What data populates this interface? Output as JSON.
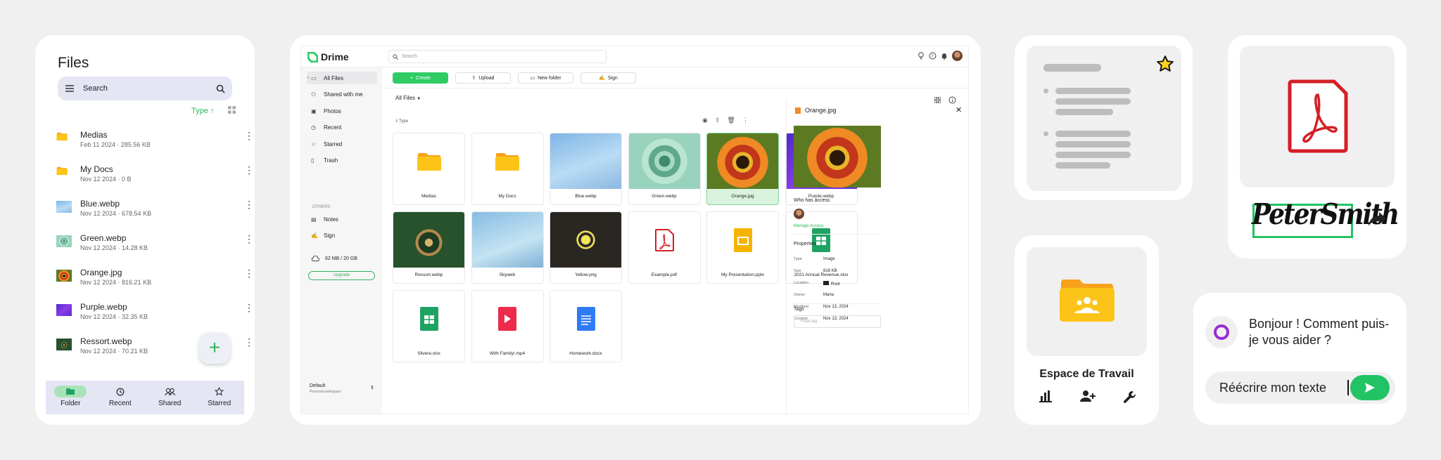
{
  "mobile": {
    "title": "Files",
    "search_placeholder": "Search",
    "sort_label": "Type",
    "files": [
      {
        "name": "Medias",
        "meta": "Feb 11 2024 · 285.56 KB",
        "kind": "folder"
      },
      {
        "name": "My Docs",
        "meta": "Nov 12 2024 · 0 B",
        "kind": "folder"
      },
      {
        "name": "Blue.webp",
        "meta": "Nov 12 2024 · 678.54 KB",
        "kind": "blue"
      },
      {
        "name": "Green.webp",
        "meta": "Nov 12 2024 · 14.28 KB",
        "kind": "green"
      },
      {
        "name": "Orange.jpg",
        "meta": "Nov 12 2024 · 816.21 KB",
        "kind": "orange"
      },
      {
        "name": "Purple.webp",
        "meta": "Nov 12 2024 · 32.35 KB",
        "kind": "purple"
      },
      {
        "name": "Ressort.webp",
        "meta": "Nov 12 2024 · 70.21 KB",
        "kind": "forest"
      }
    ],
    "nav": [
      {
        "label": "Folder",
        "icon": "folder-icon",
        "active": true
      },
      {
        "label": "Recent",
        "icon": "clock-icon"
      },
      {
        "label": "Shared",
        "icon": "users-icon"
      },
      {
        "label": "Starred",
        "icon": "star-icon"
      }
    ]
  },
  "desktop": {
    "brand": "Drime",
    "search_placeholder": "Search",
    "sidebar": {
      "items": [
        {
          "label": "All Files",
          "icon": "folder-icon"
        },
        {
          "label": "Shared with me",
          "icon": "users-icon"
        },
        {
          "label": "Photos",
          "icon": "image-icon"
        },
        {
          "label": "Recent",
          "icon": "clock-icon"
        },
        {
          "label": "Starred",
          "icon": "star-icon"
        },
        {
          "label": "Trash",
          "icon": "trash-icon"
        }
      ],
      "others_heading": "OTHERS",
      "others": [
        {
          "label": "Notes",
          "icon": "note-icon"
        },
        {
          "label": "Sign",
          "icon": "signature-icon"
        }
      ],
      "quota": "62 MB / 20 GB",
      "upgrade": "Upgrade",
      "workspace": "Default",
      "workspace_sub": "Personal workspace"
    },
    "toolbar": {
      "create": "Create",
      "upload": "Upload",
      "new_folder": "New folder",
      "sign": "Sign"
    },
    "breadcrumb": "All Files",
    "sort_label": "Type",
    "tiles": [
      {
        "name": "Medias",
        "kind": "folder"
      },
      {
        "name": "My Docs",
        "kind": "folder"
      },
      {
        "name": "Blue.webp",
        "kind": "blue"
      },
      {
        "name": "Green.webp",
        "kind": "green"
      },
      {
        "name": "Orange.jpg",
        "kind": "orange"
      },
      {
        "name": "Purple.webp",
        "kind": "purple"
      },
      {
        "name": "Ressort.webp",
        "kind": "forest"
      },
      {
        "name": "Skyweb",
        "kind": "sky"
      },
      {
        "name": "Yellow.png",
        "kind": "neon"
      },
      {
        "name": "Example.pdf",
        "kind": "pdf"
      },
      {
        "name": "My Presentation.pptx",
        "kind": "pptx"
      },
      {
        "name": "2021 Annual Revenue.xlsx",
        "kind": "xlsx"
      },
      {
        "name": "Silvere.xlsx",
        "kind": "xlsx"
      },
      {
        "name": "With Family!.mp4",
        "kind": "mp4"
      },
      {
        "name": "Homework.docx",
        "kind": "docx"
      }
    ],
    "panel": {
      "title": "Orange.jpg",
      "access_heading": "Who has access",
      "manage": "Manage Access",
      "properties_heading": "Properties",
      "props": [
        {
          "k": "Type",
          "v": "Image"
        },
        {
          "k": "Size",
          "v": "816 KB"
        },
        {
          "k": "Location",
          "v": "Root"
        },
        {
          "k": "Owner",
          "v": "Maria"
        },
        {
          "k": "Modified",
          "v": "Nov 13, 2024"
        },
        {
          "k": "Created",
          "v": "Nov 13, 2024"
        }
      ],
      "tags_heading": "Tags",
      "tags_placeholder": "+Add tag"
    }
  },
  "workspace_card": {
    "title": "Espace de Travail"
  },
  "signature": {
    "text": "PeterSmith"
  },
  "chat": {
    "question": "Bonjour ! Comment puis-je vous aider ?",
    "input": "Réécrire mon texte"
  },
  "colors": {
    "accent": "#2fcc66",
    "pdf": "#d41f26",
    "folder": "#fcc419"
  }
}
